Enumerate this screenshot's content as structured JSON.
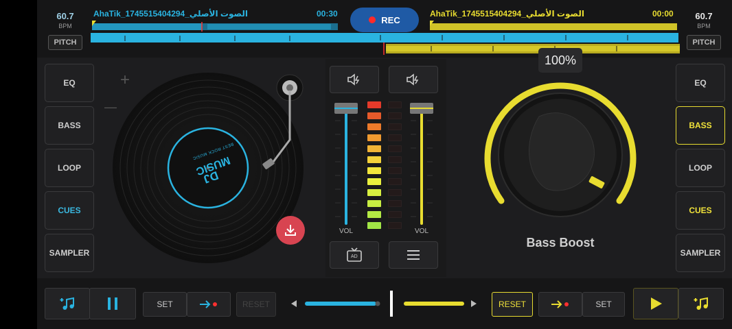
{
  "deck_left": {
    "bpm": "60.7",
    "bpm_label": "BPM",
    "pitch_label": "PITCH",
    "track": "AhaTik_1745515404294_الصوت الأصلي",
    "time": "00:30",
    "accent": "#2ab3e0",
    "buttons": [
      "EQ",
      "BASS",
      "LOOP",
      "CUES",
      "SAMPLER"
    ],
    "record_label_top": "BEST ROCK MUSIC",
    "record_label_main1": "DJ",
    "record_label_main2": "MUSIC",
    "plus": "+",
    "minus": "—"
  },
  "deck_right": {
    "bpm": "60.7",
    "bpm_label": "BPM",
    "pitch_label": "PITCH",
    "track": "AhaTik_1745515404294_الصوت الأصلي",
    "time": "00:00",
    "accent": "#e8dc30",
    "buttons": [
      "EQ",
      "BASS",
      "LOOP",
      "CUES",
      "SAMPLER"
    ],
    "knob_percent": "100%",
    "knob_label": "Bass Boost"
  },
  "rec_label": "REC",
  "mixer": {
    "vol_left": "VOL",
    "vol_right": "VOL",
    "ad_label": "AD"
  },
  "bottom": {
    "set_left": "SET",
    "reset_left": "RESET",
    "reset_right": "RESET",
    "set_right": "SET"
  }
}
